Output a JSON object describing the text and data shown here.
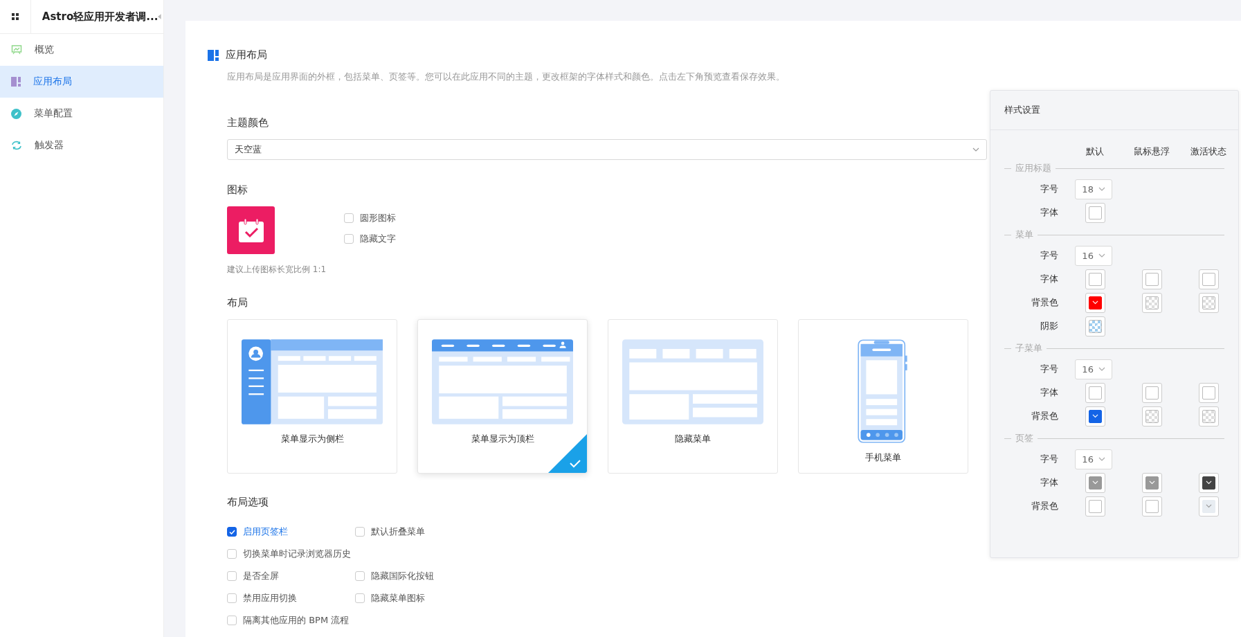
{
  "sidebar": {
    "title": "Astro轻应用开发者调...",
    "items": [
      {
        "label": "概览",
        "kind": "overview",
        "selected": false
      },
      {
        "label": "应用布局",
        "kind": "layout",
        "selected": true
      },
      {
        "label": "菜单配置",
        "kind": "menu",
        "selected": false
      },
      {
        "label": "触发器",
        "kind": "trigger",
        "selected": false
      }
    ]
  },
  "page": {
    "title": "应用布局",
    "description": "应用布局是应用界面的外框，包括菜单、页签等。您可以在此应用不同的主题，更改框架的字体样式和颜色。点击左下角预览查看保存效果。"
  },
  "theme": {
    "label": "主题颜色",
    "value": "天空蓝"
  },
  "icon": {
    "label": "图标",
    "color": "#ec1d63",
    "hint": "建议上传图标长宽比例 1:1",
    "options": [
      {
        "label": "圆形图标",
        "checked": false
      },
      {
        "label": "隐藏文字",
        "checked": false
      }
    ]
  },
  "layout": {
    "label": "布局",
    "cards": [
      {
        "label": "菜单显示为侧栏",
        "kind": "sidebar",
        "selected": false
      },
      {
        "label": "菜单显示为顶栏",
        "kind": "topbar",
        "selected": true
      },
      {
        "label": "隐藏菜单",
        "kind": "hidden",
        "selected": false
      },
      {
        "label": "手机菜单",
        "kind": "mobile",
        "selected": false
      }
    ]
  },
  "layout_options": {
    "label": "布局选项",
    "rows": [
      [
        {
          "label": "启用页签栏",
          "checked": true
        },
        {
          "label": "默认折叠菜单",
          "checked": false
        }
      ],
      [
        {
          "label": "切换菜单时记录浏览器历史",
          "checked": false
        }
      ],
      [
        {
          "label": "是否全屏",
          "checked": false
        },
        {
          "label": "隐藏国际化按钮",
          "checked": false
        }
      ],
      [
        {
          "label": "禁用应用切换",
          "checked": false
        },
        {
          "label": "隐藏菜单图标",
          "checked": false
        }
      ],
      [
        {
          "label": "隔离其他应用的 BPM 流程",
          "checked": false
        }
      ]
    ]
  },
  "style_panel": {
    "title": "样式设置",
    "columns": [
      "默认",
      "鼠标悬浮",
      "激活状态"
    ],
    "sections": [
      {
        "title": "应用标题",
        "rows": [
          {
            "label": "字号",
            "kind": "select",
            "value": "18"
          },
          {
            "label": "字体",
            "kind": "swatches",
            "swatches": [
              {
                "kind": "solid",
                "color": "#ffffff",
                "caret": false
              }
            ]
          }
        ]
      },
      {
        "title": "菜单",
        "rows": [
          {
            "label": "字号",
            "kind": "select",
            "value": "16"
          },
          {
            "label": "字体",
            "kind": "swatches",
            "swatches": [
              {
                "kind": "solid",
                "color": "#ffffff",
                "caret": false
              },
              {
                "kind": "solid",
                "color": "#ffffff",
                "caret": false
              },
              {
                "kind": "solid",
                "color": "#ffffff",
                "caret": false
              }
            ]
          },
          {
            "label": "背景色",
            "kind": "swatches",
            "swatches": [
              {
                "kind": "solid",
                "color": "#ff0000",
                "caret": true
              },
              {
                "kind": "checker",
                "color": "#dddddd",
                "caret": false
              },
              {
                "kind": "checker",
                "color": "#dddddd",
                "caret": false
              }
            ]
          },
          {
            "label": "阴影",
            "kind": "swatches",
            "swatches": [
              {
                "kind": "checker",
                "color": "#9fcdef",
                "caret": true
              }
            ]
          }
        ]
      },
      {
        "title": "子菜单",
        "rows": [
          {
            "label": "字号",
            "kind": "select",
            "value": "16"
          },
          {
            "label": "字体",
            "kind": "swatches",
            "swatches": [
              {
                "kind": "solid",
                "color": "#ffffff",
                "caret": false
              },
              {
                "kind": "solid",
                "color": "#ffffff",
                "caret": false
              },
              {
                "kind": "solid",
                "color": "#ffffff",
                "caret": false
              }
            ]
          },
          {
            "label": "背景色",
            "kind": "swatches",
            "swatches": [
              {
                "kind": "solid",
                "color": "#1464e6",
                "caret": true
              },
              {
                "kind": "checker",
                "color": "#dddddd",
                "caret": false
              },
              {
                "kind": "checker",
                "color": "#dddddd",
                "caret": false
              }
            ]
          }
        ]
      },
      {
        "title": "页签",
        "rows": [
          {
            "label": "字号",
            "kind": "select",
            "value": "16"
          },
          {
            "label": "字体",
            "kind": "swatches",
            "swatches": [
              {
                "kind": "solid",
                "color": "#999999",
                "caret": true
              },
              {
                "kind": "solid",
                "color": "#999999",
                "caret": true
              },
              {
                "kind": "solid",
                "color": "#444444",
                "caret": true
              }
            ]
          },
          {
            "label": "背景色",
            "kind": "swatches",
            "swatches": [
              {
                "kind": "solid",
                "color": "#ffffff",
                "caret": false
              },
              {
                "kind": "solid",
                "color": "#ffffff",
                "caret": false
              },
              {
                "kind": "solid",
                "color": "#e8edf2",
                "caret": true
              }
            ]
          }
        ]
      }
    ]
  }
}
